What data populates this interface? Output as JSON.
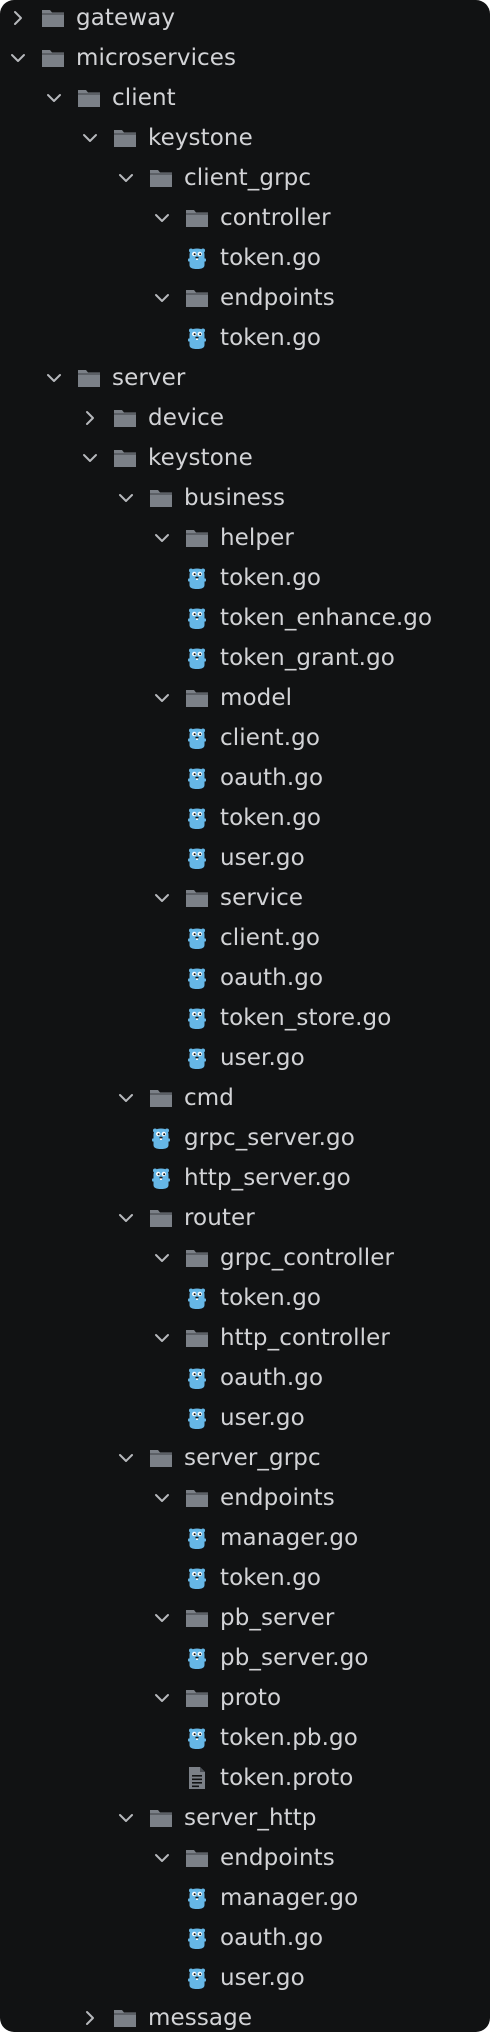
{
  "colors": {
    "background": "#111213",
    "text": "#d2d3d6",
    "folder": "#7b8087",
    "chevron": "#b6b8bc",
    "gopher": "#66b7e6"
  },
  "tree": {
    "items": [
      {
        "label": "gateway",
        "type": "folder",
        "depth": 0,
        "state": "collapsed"
      },
      {
        "label": "microservices",
        "type": "folder",
        "depth": 0,
        "state": "expanded"
      },
      {
        "label": "client",
        "type": "folder",
        "depth": 1,
        "state": "expanded"
      },
      {
        "label": "keystone",
        "type": "folder",
        "depth": 2,
        "state": "expanded"
      },
      {
        "label": "client_grpc",
        "type": "folder",
        "depth": 3,
        "state": "expanded"
      },
      {
        "label": "controller",
        "type": "folder",
        "depth": 4,
        "state": "expanded"
      },
      {
        "label": "token.go",
        "type": "go",
        "depth": 5
      },
      {
        "label": "endpoints",
        "type": "folder",
        "depth": 4,
        "state": "expanded"
      },
      {
        "label": "token.go",
        "type": "go",
        "depth": 5
      },
      {
        "label": "server",
        "type": "folder",
        "depth": 1,
        "state": "expanded"
      },
      {
        "label": "device",
        "type": "folder",
        "depth": 2,
        "state": "collapsed"
      },
      {
        "label": "keystone",
        "type": "folder",
        "depth": 2,
        "state": "expanded"
      },
      {
        "label": "business",
        "type": "folder",
        "depth": 3,
        "state": "expanded"
      },
      {
        "label": "helper",
        "type": "folder",
        "depth": 4,
        "state": "expanded"
      },
      {
        "label": "token.go",
        "type": "go",
        "depth": 5
      },
      {
        "label": "token_enhance.go",
        "type": "go",
        "depth": 5
      },
      {
        "label": "token_grant.go",
        "type": "go",
        "depth": 5
      },
      {
        "label": "model",
        "type": "folder",
        "depth": 4,
        "state": "expanded"
      },
      {
        "label": "client.go",
        "type": "go",
        "depth": 5
      },
      {
        "label": "oauth.go",
        "type": "go",
        "depth": 5
      },
      {
        "label": "token.go",
        "type": "go",
        "depth": 5
      },
      {
        "label": "user.go",
        "type": "go",
        "depth": 5
      },
      {
        "label": "service",
        "type": "folder",
        "depth": 4,
        "state": "expanded"
      },
      {
        "label": "client.go",
        "type": "go",
        "depth": 5
      },
      {
        "label": "oauth.go",
        "type": "go",
        "depth": 5
      },
      {
        "label": "token_store.go",
        "type": "go",
        "depth": 5
      },
      {
        "label": "user.go",
        "type": "go",
        "depth": 5
      },
      {
        "label": "cmd",
        "type": "folder",
        "depth": 3,
        "state": "expanded"
      },
      {
        "label": "grpc_server.go",
        "type": "go",
        "depth": 4
      },
      {
        "label": "http_server.go",
        "type": "go",
        "depth": 4
      },
      {
        "label": "router",
        "type": "folder",
        "depth": 3,
        "state": "expanded"
      },
      {
        "label": "grpc_controller",
        "type": "folder",
        "depth": 4,
        "state": "expanded"
      },
      {
        "label": "token.go",
        "type": "go",
        "depth": 5
      },
      {
        "label": "http_controller",
        "type": "folder",
        "depth": 4,
        "state": "expanded"
      },
      {
        "label": "oauth.go",
        "type": "go",
        "depth": 5
      },
      {
        "label": "user.go",
        "type": "go",
        "depth": 5
      },
      {
        "label": "server_grpc",
        "type": "folder",
        "depth": 3,
        "state": "expanded"
      },
      {
        "label": "endpoints",
        "type": "folder",
        "depth": 4,
        "state": "expanded"
      },
      {
        "label": "manager.go",
        "type": "go",
        "depth": 5
      },
      {
        "label": "token.go",
        "type": "go",
        "depth": 5
      },
      {
        "label": "pb_server",
        "type": "folder",
        "depth": 4,
        "state": "expanded"
      },
      {
        "label": "pb_server.go",
        "type": "go",
        "depth": 5
      },
      {
        "label": "proto",
        "type": "folder",
        "depth": 4,
        "state": "expanded"
      },
      {
        "label": "token.pb.go",
        "type": "go",
        "depth": 5
      },
      {
        "label": "token.proto",
        "type": "text",
        "depth": 5
      },
      {
        "label": "server_http",
        "type": "folder",
        "depth": 3,
        "state": "expanded"
      },
      {
        "label": "endpoints",
        "type": "folder",
        "depth": 4,
        "state": "expanded"
      },
      {
        "label": "manager.go",
        "type": "go",
        "depth": 5
      },
      {
        "label": "oauth.go",
        "type": "go",
        "depth": 5
      },
      {
        "label": "user.go",
        "type": "go",
        "depth": 5
      },
      {
        "label": "message",
        "type": "folder",
        "depth": 2,
        "state": "collapsed"
      }
    ]
  }
}
